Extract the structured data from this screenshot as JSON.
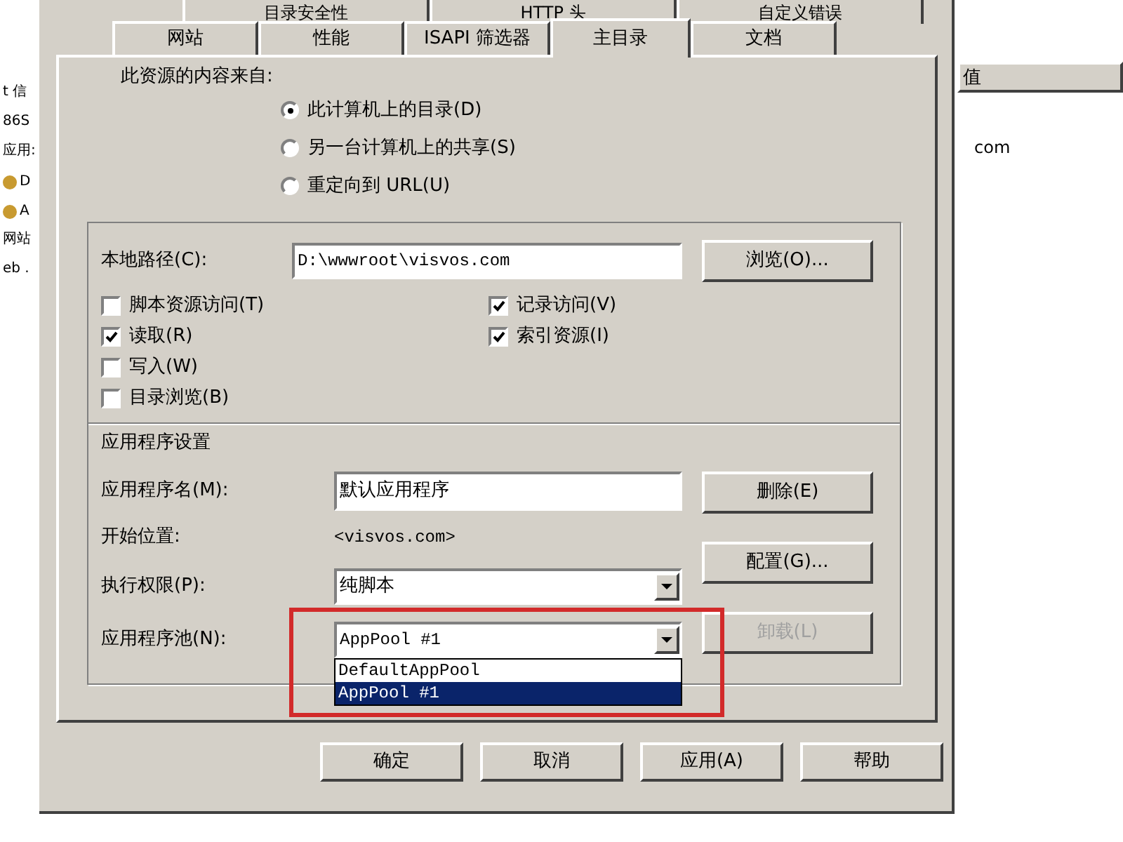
{
  "background_window": {
    "left_items": [
      {
        "label": "t 信",
        "kind": "text"
      },
      {
        "label": "86S",
        "kind": "text"
      },
      {
        "label": "应用:",
        "kind": "text"
      },
      {
        "label": "D",
        "kind": "icon"
      },
      {
        "label": "A",
        "kind": "icon"
      },
      {
        "label": "网站",
        "kind": "text"
      },
      {
        "label": "eb .",
        "kind": "text"
      }
    ],
    "column_header": "值",
    "cell": "com"
  },
  "tabs_back": [
    "目录安全性",
    "HTTP 头",
    "自定义错误"
  ],
  "tabs": [
    {
      "label": "网站",
      "selected": false
    },
    {
      "label": "性能",
      "selected": false
    },
    {
      "label": "ISAPI 筛选器",
      "selected": false
    },
    {
      "label": "主目录",
      "selected": true
    },
    {
      "label": "文档",
      "selected": false
    }
  ],
  "content_source": {
    "label": "此资源的内容来自:",
    "options": [
      {
        "label": "此计算机上的目录(D)",
        "selected": true
      },
      {
        "label": "另一台计算机上的共享(S)",
        "selected": false
      },
      {
        "label": "重定向到 URL(U)",
        "selected": false
      }
    ]
  },
  "local_path": {
    "label": "本地路径(C):",
    "value": "D:\\wwwroot\\visvos.com",
    "button": "浏览(O)..."
  },
  "permissions_left": [
    {
      "label": "脚本资源访问(T)",
      "checked": false
    },
    {
      "label": "读取(R)",
      "checked": true
    },
    {
      "label": "写入(W)",
      "checked": false
    },
    {
      "label": "目录浏览(B)",
      "checked": false
    }
  ],
  "permissions_right": [
    {
      "label": "记录访问(V)",
      "checked": true
    },
    {
      "label": "索引资源(I)",
      "checked": true
    }
  ],
  "app_settings": {
    "title": "应用程序设置",
    "name_label": "应用程序名(M):",
    "name_value": "默认应用程序",
    "start_label": "开始位置:",
    "start_value": "<visvos.com>",
    "exec_label": "执行权限(P):",
    "exec_value": "纯脚本",
    "pool_label": "应用程序池(N):",
    "pool_value": "AppPool #1",
    "pool_options": [
      {
        "label": "DefaultAppPool",
        "selected": false
      },
      {
        "label": "AppPool #1",
        "selected": true
      }
    ],
    "buttons": [
      {
        "label": "删除(E)",
        "disabled": false
      },
      {
        "label": "配置(G)...",
        "disabled": false
      },
      {
        "label": "卸载(L)",
        "disabled": true
      }
    ]
  },
  "dialog_buttons": [
    "确定",
    "取消",
    "应用(A)",
    "帮助"
  ]
}
